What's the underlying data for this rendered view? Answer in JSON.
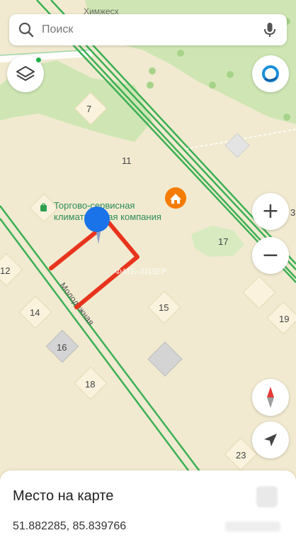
{
  "search": {
    "placeholder": "Поиск"
  },
  "map": {
    "houses": [
      "7",
      "11",
      "17",
      "12",
      "14",
      "15",
      "16",
      "18",
      "19",
      "23",
      "3"
    ],
    "poi_label_line1": "Торгово-сервисная",
    "poi_label_line2": "климатическая компания",
    "street_label": "Молодежная",
    "top_street_label": "Химжесх",
    "watermark": "ФАТЕ-ЛИДЕР"
  },
  "controls": {
    "zoom_in": "+",
    "zoom_out": "−"
  },
  "place": {
    "title": "Место на карте",
    "coordinates": "51.882285, 85.839766"
  },
  "colors": {
    "map_background": "#f1ead0",
    "park_green": "#cfe6b4",
    "road_green": "#3cb054",
    "plot_outline": "#e8341c",
    "pin_blue": "#1a73e8",
    "poi_orange": "#f57c00",
    "brand_blue": "#1a8ed8"
  }
}
